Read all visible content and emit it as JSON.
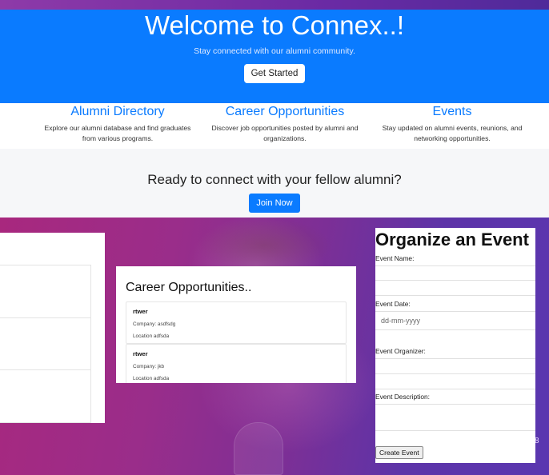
{
  "hero": {
    "title": "Welcome to Connex..!",
    "subtitle": "Stay connected with our alumni community.",
    "cta_label": "Get Started"
  },
  "features": [
    {
      "title": "Alumni Directory",
      "text": "Explore our alumni database and find graduates from various programs."
    },
    {
      "title": "Career Opportunities",
      "text": "Discover job opportunities posted by alumni and organizations."
    },
    {
      "title": "Events",
      "text": "Stay updated on alumni events, reunions, and networking opportunities."
    }
  ],
  "cta": {
    "heading": "Ready to connect with your fellow alumni?",
    "button_label": "Join Now"
  },
  "career_card": {
    "title": "Career Opportunities..",
    "jobs": [
      {
        "title": "rtwer",
        "company": "Company: asdfsdg",
        "location": "Location adfsda"
      },
      {
        "title": "rtwer",
        "company": "Company: jkb",
        "location": "Location adfsda"
      }
    ]
  },
  "event_form": {
    "title": "Organize an Event",
    "name_label": "Event Name:",
    "date_label": "Event Date:",
    "date_placeholder": "dd-mm-yyyy",
    "organizer_label": "Event Organizer:",
    "description_label": "Event Description:",
    "submit_label": "Create Event"
  },
  "corner_digit": "8",
  "colors": {
    "primary": "#0a7bff",
    "background_gradient_start": "#a8287e",
    "background_gradient_end": "#5a36b0"
  }
}
